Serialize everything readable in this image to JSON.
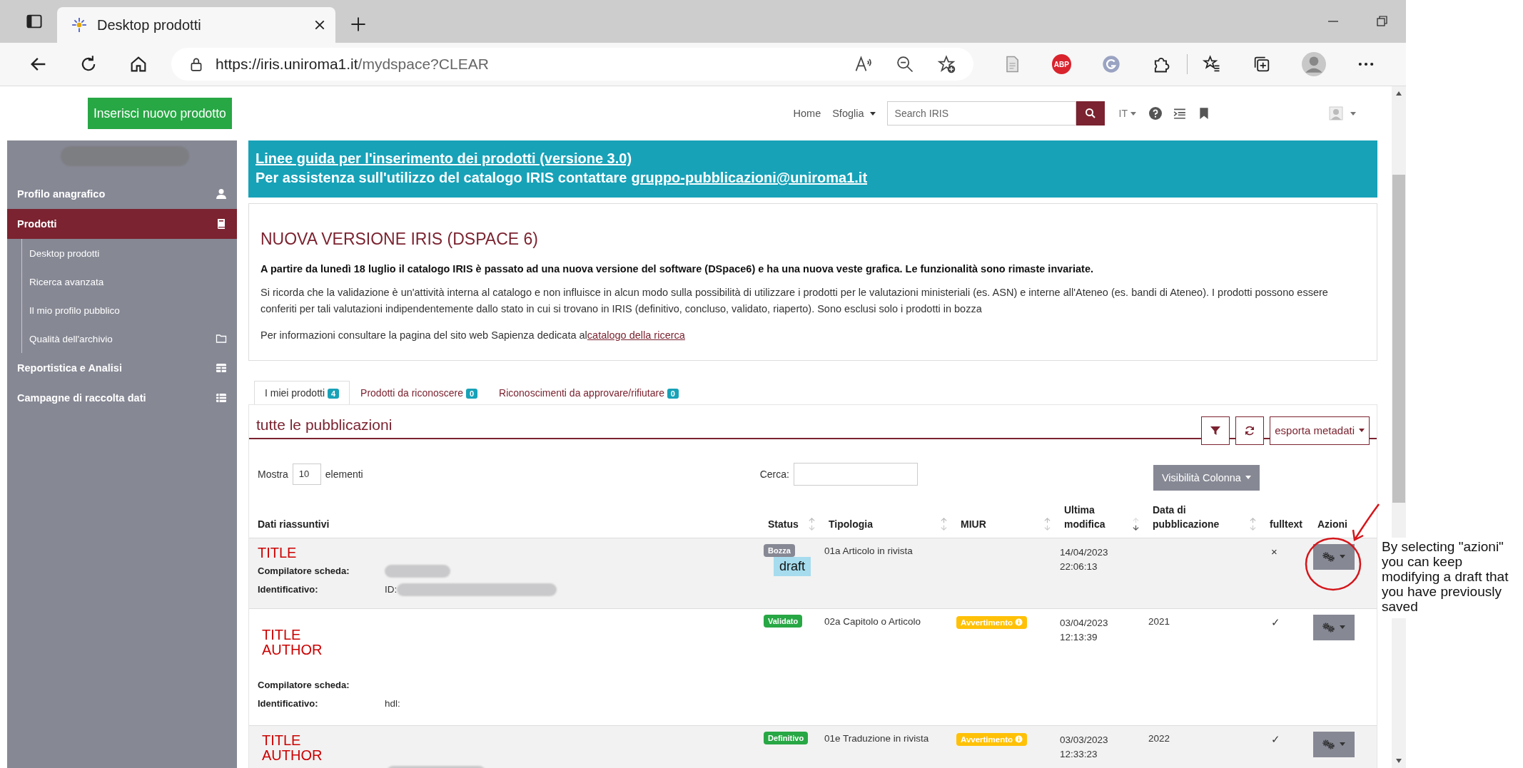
{
  "browser": {
    "tab_title": "Desktop prodotti",
    "url_host": "https://iris.uniroma1.it",
    "url_path": "/mydspace?CLEAR",
    "adblock_label": "ABP"
  },
  "header": {
    "new_button": "Inserisci nuovo prodotto",
    "nav": [
      {
        "label": "Home",
        "dropdown": false
      },
      {
        "label": "Sfoglia",
        "dropdown": true
      }
    ],
    "search_placeholder": "Search IRIS",
    "language": "IT"
  },
  "sidebar": {
    "user_redacted": true,
    "items": [
      {
        "label": "Profilo anagrafico",
        "selected": false
      },
      {
        "label": "Prodotti",
        "selected": true,
        "children": [
          {
            "label": "Desktop prodotti"
          },
          {
            "label": "Ricerca avanzata"
          },
          {
            "label": "Il mio profilo pubblico"
          },
          {
            "label": "Qualità dell'archivio"
          }
        ]
      },
      {
        "label": "Reportistica e Analisi",
        "selected": false
      },
      {
        "label": "Campagne di raccolta dati",
        "selected": false
      }
    ]
  },
  "banner": {
    "lines": [
      {
        "link": "Linee guida per l'inserimento dei prodotti (versione 3.0)"
      },
      {
        "text": "Per assistenza sull'utilizzo del catalogo IRIS contattare",
        "link": "gruppo-pubblicazioni@uniroma1.it"
      }
    ]
  },
  "notice": {
    "title": "NUOVA VERSIONE IRIS (DSPACE 6)",
    "lead": "A partire da lunedì 18 luglio il catalogo IRIS è passato ad una nuova versione del software (DSpace6) e ha una nuova veste grafica. Le funzionalità sono rimaste invariate.",
    "paragraphs": [
      {
        "text": "Si ricorda che la validazione è un'attività interna al catalogo e non influisce in alcun modo sulla possibilità di utilizzare i prodotti per le valutazioni ministeriali (es. ASN) e interne all'Ateneo (es. bandi di Ateneo). I prodotti possono essere conferiti per tali valutazioni indipendentemente dallo stato in cui si trovano in IRIS (definitivo, concluso, validato, riaperto). Sono esclusi solo i prodotti in bozza"
      },
      {
        "text": "Per informazioni consultare la pagina del sito web Sapienza dedicata al",
        "link": "catalogo della ricerca"
      }
    ]
  },
  "tabs": [
    {
      "label": "I miei prodotti",
      "count": "4",
      "selected": true
    },
    {
      "label": "Prodotti da riconoscere",
      "count": "0",
      "selected": false
    },
    {
      "label": "Riconoscimenti da approvare/rifiutare",
      "count": "0",
      "selected": false
    }
  ],
  "panel": {
    "title": "tutte le pubblicazioni",
    "export_button": "esporta metadati"
  },
  "controls": {
    "show_label": "Mostra",
    "page_size": "10",
    "show_suffix": "elementi",
    "search_label": "Cerca:",
    "columns_button": "Visibilità Colonna"
  },
  "columns": [
    {
      "label": "Dati riassuntivi",
      "sortable": false
    },
    {
      "label": "Status",
      "sortable": true,
      "sorted": false
    },
    {
      "label": "Tipologia",
      "sortable": true,
      "sorted": false
    },
    {
      "label": "MIUR",
      "sortable": true,
      "sorted": false
    },
    {
      "label": "Ultima modifica",
      "sortable": true,
      "sorted": true
    },
    {
      "label": "Data di pubblicazione",
      "sortable": true,
      "sorted": false
    },
    {
      "label": "fulltext",
      "sortable": false
    },
    {
      "label": "Azioni",
      "sortable": false
    }
  ],
  "rows": [
    {
      "title_lines": [
        "TITLE"
      ],
      "redacted": false,
      "fields": [
        {
          "label": "Compilatore scheda:",
          "redacted": true
        },
        {
          "label": "Identificativo:",
          "value": "ID:",
          "redacted": true
        }
      ],
      "status": {
        "label": "Bozza",
        "kind": "draft"
      },
      "draft_note": "draft",
      "typology": "01a Articolo in rivista",
      "modified_date": "14/04/2023",
      "modified_time": "22:06:13",
      "fulltext": "×",
      "circled": true
    },
    {
      "title_lines": [
        "TITLE",
        "AUTHOR"
      ],
      "redacted": false,
      "fields": [
        {
          "label": "Compilatore scheda:",
          "redacted": false
        },
        {
          "label": "Identificativo:",
          "value": "hdl:",
          "redacted": false
        }
      ],
      "status": {
        "label": "Validato",
        "kind": "validated"
      },
      "typology": "02a Capitolo o Articolo",
      "miur": {
        "label": "Avvertimento",
        "kind": "warning"
      },
      "modified_date": "03/04/2023",
      "modified_time": "12:13:39",
      "year": "2021",
      "fulltext": "✓",
      "circled": false
    },
    {
      "title_lines": [
        "TITLE",
        "AUTHOR"
      ],
      "redacted": true,
      "status": {
        "label": "Definitivo",
        "kind": "final"
      },
      "typology": "01e Traduzione in rivista",
      "miur": {
        "label": "Avvertimento",
        "kind": "warning"
      },
      "modified_date": "03/03/2023",
      "modified_time": "12:33:23",
      "year": "2022",
      "fulltext": "✓",
      "circled": false
    }
  ],
  "annotation": {
    "text": "By selecting \"azioni\" you can keep modifying a draft that you have previously saved"
  }
}
